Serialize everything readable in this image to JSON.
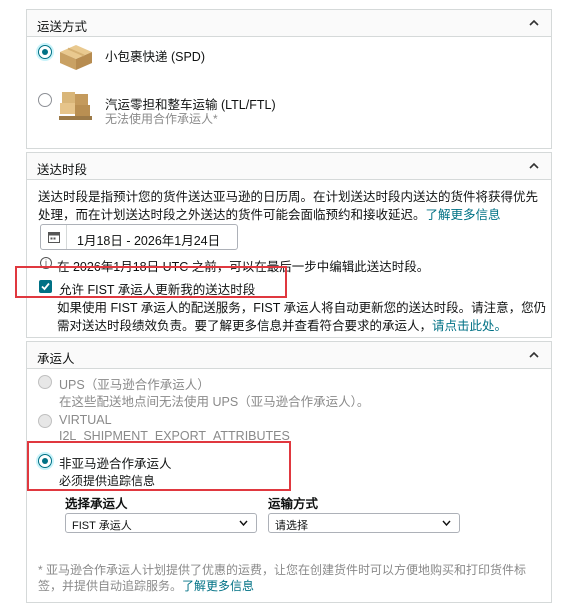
{
  "shipping_method": {
    "title": "运送方式",
    "options": [
      {
        "label": "小包裹快递 (SPD)",
        "selected": true
      },
      {
        "label": "汽运零担和整车运输 (LTL/FTL)",
        "sub": "无法使用合作承运人*",
        "selected": false
      }
    ]
  },
  "delivery_window": {
    "title": "送达时段",
    "desc_line1": "送达时段是指预计您的货件送达亚马逊的日历周。在计划送达时段内送达的货件将获得优先",
    "desc_line2": "处理，而在计划送达时段之外送达的货件可能会面临预约和接收延迟。",
    "learn_more": "了解更多信息",
    "date_range": "1月18日 - 2026年1月24日",
    "note": "在 2026年1月18日 UTC 之前，可以在最后一步中编辑此送达时段。",
    "checkbox_label": "允许 FIST 承运人更新我的送达时段",
    "checkbox_checked": true,
    "explain_line1": "如果使用 FIST 承运人的配送服务，FIST 承运人将自动更新您的送达时段。请注意，您仍",
    "explain_line2": "需对送达时段绩效负责。要了解更多信息并查看符合要求的承运人，",
    "explain_link": "请点击此处。"
  },
  "carrier": {
    "title": "承运人",
    "options": [
      {
        "label": "UPS（亚马逊合作承运人）",
        "sub": "在这些配送地点间无法使用 UPS（亚马逊合作承运人）。",
        "disabled": true
      },
      {
        "label": "VIRTUAL",
        "sub": "I2L_SHIPMENT_EXPORT_ATTRIBUTES",
        "disabled": true
      },
      {
        "label": "非亚马逊合作承运人",
        "sub": "必须提供追踪信息",
        "selected": true
      }
    ],
    "select_carrier_label": "选择承运人",
    "select_carrier_value": "FIST 承运人",
    "transport_label": "运输方式",
    "transport_value": "请选择",
    "footnote_line1": "* 亚马逊合作承运人计划提供了优惠的运费，让您在创建货件时可以方便地购买和打印货件标",
    "footnote_line2": "签，并提供自动追踪服务。",
    "footnote_link": "了解更多信息"
  },
  "colors": {
    "accent": "#007185",
    "highlight": "#e0383f",
    "border": "#d5d9d9"
  }
}
